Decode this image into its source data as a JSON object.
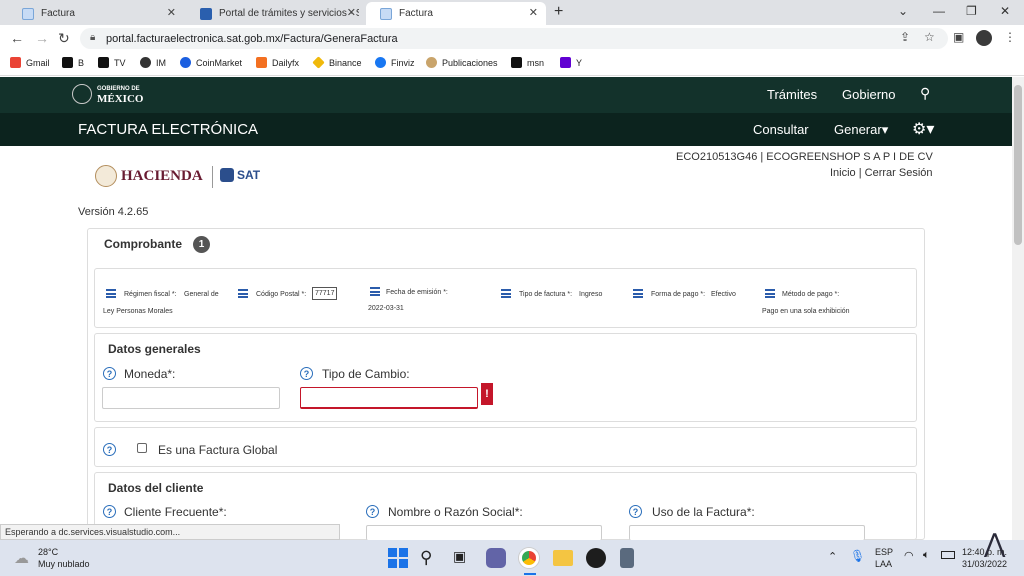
{
  "browser": {
    "tabs": [
      {
        "title": "Factura",
        "active": false
      },
      {
        "title": "Portal de trámites y servicios - SA",
        "active": false
      },
      {
        "title": "Factura",
        "active": true
      }
    ],
    "new_tab": "+",
    "url": "portal.facturaelectronica.sat.gob.mx/Factura/GeneraFactura",
    "bookmarks": [
      "Gmail",
      "B",
      "TV",
      "IM",
      "CoinMarket",
      "Dailyfx",
      "Binance",
      "Finviz",
      "Publicaciones",
      "msn",
      "Y"
    ],
    "status_text": "Esperando a dc.services.visualstudio.com..."
  },
  "gob_header": {
    "logo_line1": "GOBIERNO DE",
    "logo_line2": "MÉXICO",
    "tramites": "Trámites",
    "gobierno": "Gobierno"
  },
  "fe_header": {
    "title": "FACTURA ELECTRÓNICA",
    "consultar": "Consultar",
    "generar": "Generar▾"
  },
  "identity": {
    "hacienda": "HACIENDA",
    "sat": "SAT",
    "rfc_line": "ECO210513G46 | ECOGREENSHOP S A P I DE CV",
    "inicio": "Inicio",
    "sep": "|",
    "cerrar": "Cerrar Sesión",
    "version": "Versión 4.2.65"
  },
  "comprobante": {
    "title": "Comprobante",
    "step": "1",
    "regimen_label": "Régimen fiscal *:",
    "regimen_value_a": "General de",
    "regimen_value_b": "Ley Personas Morales",
    "cp_label": "Código Postal *:",
    "cp_value": "77717",
    "fecha_label": "Fecha de emisión *:",
    "fecha_value": "2022-03-31",
    "tipo_label": "Tipo de factura *:",
    "tipo_value": "Ingreso",
    "forma_label": "Forma de pago *:",
    "forma_value": "Efectivo",
    "metodo_label": "Método de pago *:",
    "metodo_value": "Pago en una sola exhibición"
  },
  "datos_generales": {
    "title": "Datos generales",
    "moneda_label": "Moneda*:",
    "tipo_cambio_label": "Tipo de Cambio:",
    "error_badge": "!"
  },
  "factura_global": {
    "label": "Es una Factura Global"
  },
  "datos_cliente": {
    "title": "Datos del cliente",
    "cliente_label": "Cliente Frecuente*:",
    "nombre_label": "Nombre o Razón Social*:",
    "uso_label": "Uso de la Factura*:"
  },
  "taskbar": {
    "temp": "28°C",
    "weather": "Muy nublado",
    "lang1": "ESP",
    "lang2": "LAA",
    "time": "12:40 p. m.",
    "date": "31/03/2022"
  }
}
